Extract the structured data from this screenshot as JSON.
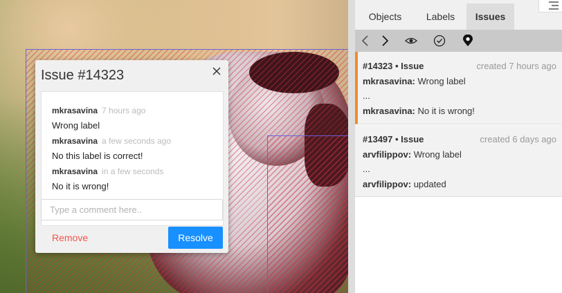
{
  "dialog": {
    "title": "Issue #14323",
    "comments": [
      {
        "author": "mkrasavina",
        "time": "7 hours ago",
        "message": "Wrong label"
      },
      {
        "author": "mkrasavina",
        "time": "a few seconds ago",
        "message": "No this label is correct!"
      },
      {
        "author": "mkrasavina",
        "time": "in a few seconds",
        "message": "No it is wrong!"
      }
    ],
    "input_placeholder": "Type a comment here..",
    "remove_label": "Remove",
    "resolve_label": "Resolve"
  },
  "panel": {
    "tabs": [
      {
        "label": "Objects"
      },
      {
        "label": "Labels"
      },
      {
        "label": "Issues"
      }
    ],
    "issues": [
      {
        "header": "#14323 • Issue",
        "created": "created 7 hours ago",
        "first_author": "mkrasavina:",
        "first_message": "Wrong label",
        "ellipsis": "...",
        "last_author": "mkrasavina:",
        "last_message": "No it is wrong!"
      },
      {
        "header": "#13497 • Issue",
        "created": "created 6 days ago",
        "first_author": "arvfilippov:",
        "first_message": "Wrong label",
        "ellipsis": "...",
        "last_author": "arvfilippov:",
        "last_message": "updated"
      }
    ]
  },
  "colors": {
    "accent": "#1890ff",
    "remove": "#f5554a",
    "selected_issue_border": "#f08c2c",
    "shape_border": "#6a60d8"
  }
}
